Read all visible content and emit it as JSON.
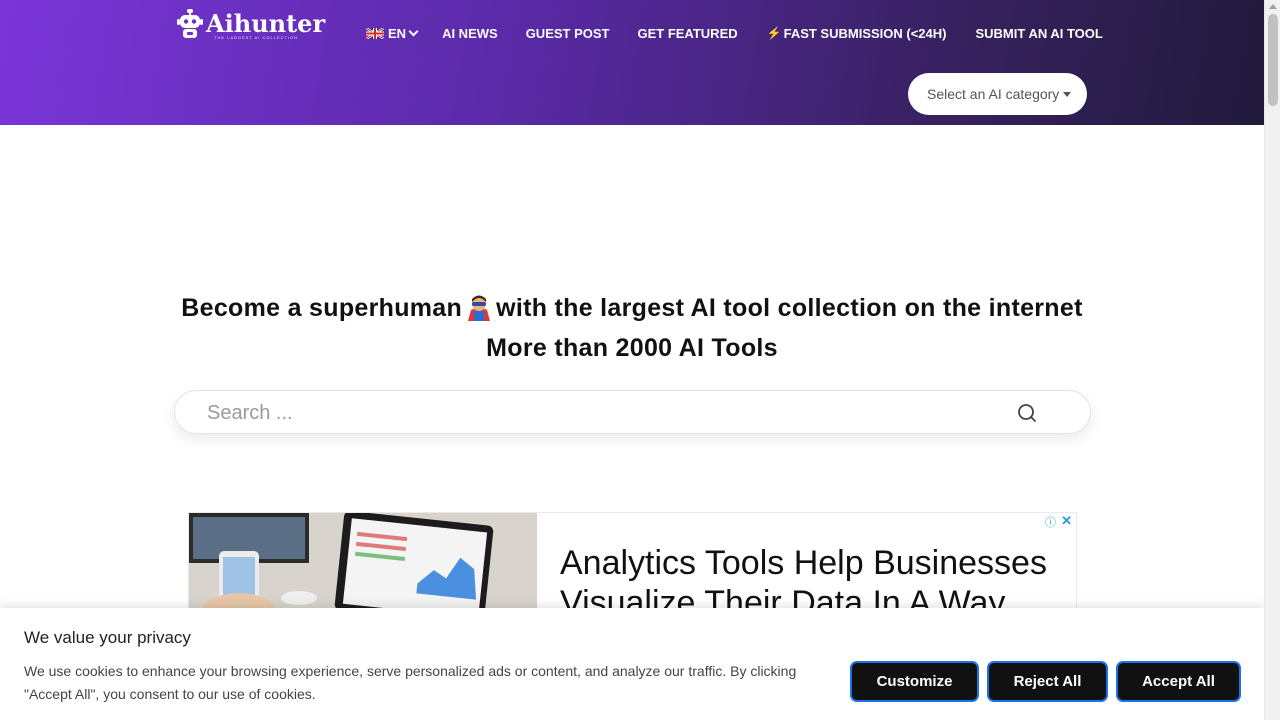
{
  "header": {
    "logo_text": "Aihunter",
    "logo_tagline": "THE LARGEST AI COLLECTION",
    "nav": {
      "language": "EN",
      "items": [
        "AI NEWS",
        "GUEST POST",
        "GET FEATURED",
        "FAST SUBMISSION (<24H)",
        "SUBMIT AN AI TOOL"
      ]
    },
    "category_select": "Select an AI category"
  },
  "hero": {
    "line1_before": "Become a superhuman",
    "line1_after": "with the largest AI tool collection on the internet",
    "line2": "More than 2000 AI Tools"
  },
  "search": {
    "placeholder": "Search ..."
  },
  "ad": {
    "title": "Analytics Tools Help Businesses Visualize Their Data In A Way",
    "info_icon": "ⓘ",
    "close_icon": "✕"
  },
  "cookie": {
    "title": "We value your privacy",
    "text": "We use cookies to enhance your browsing experience, serve personalized ads or content, and analyze our traffic. By clicking \"Accept All\", you consent to our use of cookies.",
    "buttons": {
      "customize": "Customize",
      "reject": "Reject All",
      "accept": "Accept All"
    }
  },
  "colors": {
    "header_start": "#7a35d8",
    "header_end": "#201a3c",
    "button_bg": "#111111",
    "button_border": "#1a73e8"
  }
}
